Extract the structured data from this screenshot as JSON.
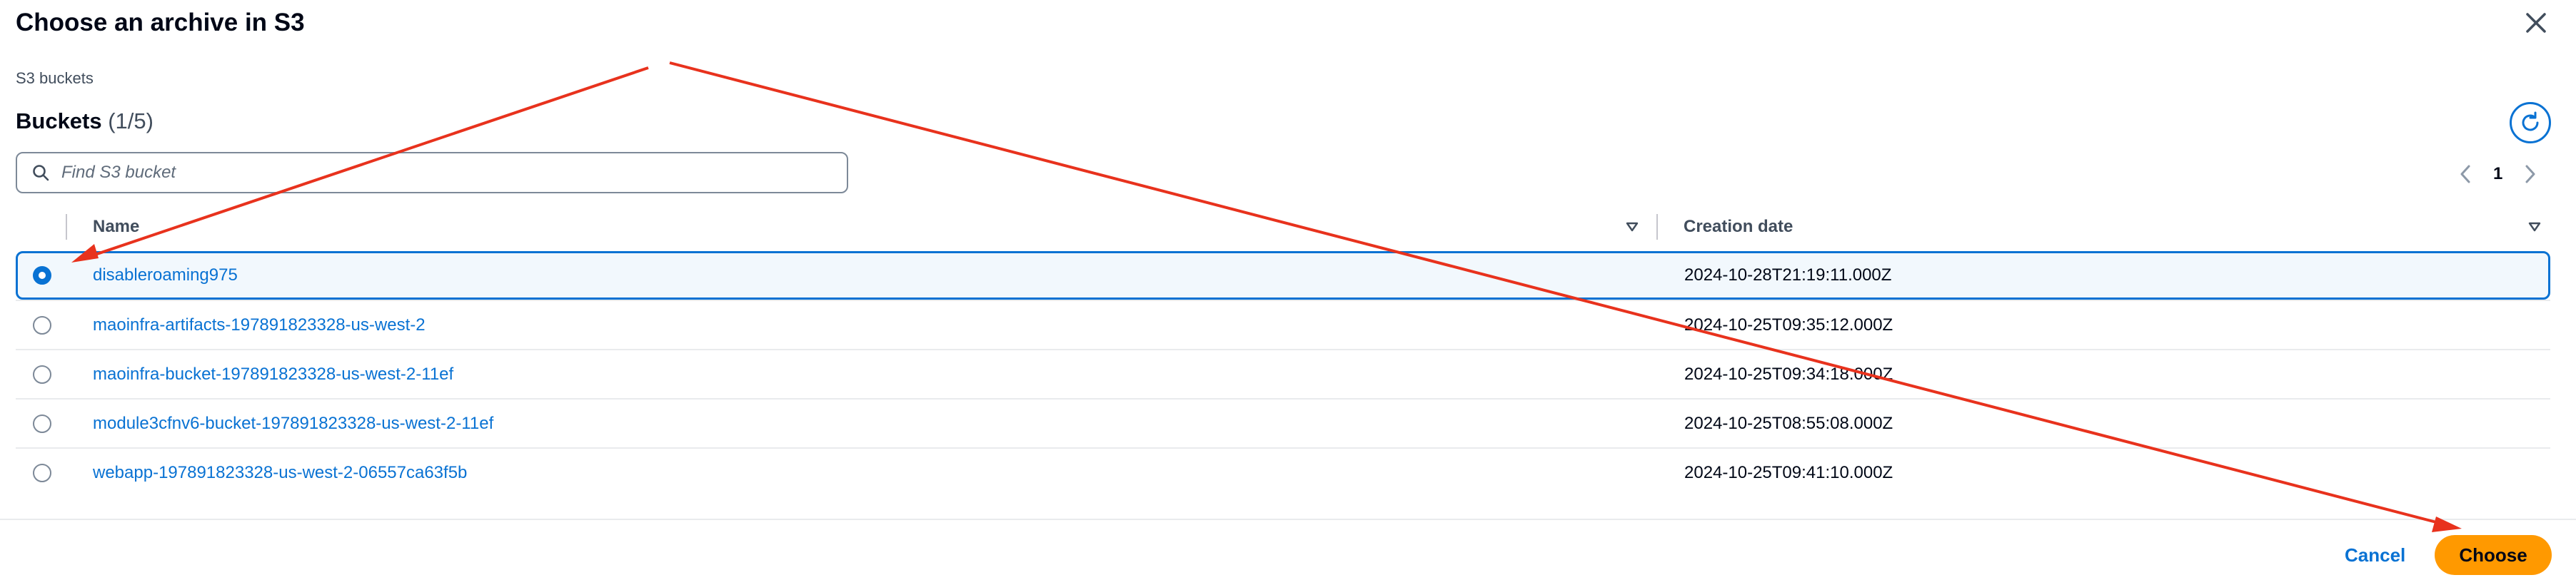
{
  "modal": {
    "title": "Choose an archive in S3",
    "section_label": "S3 buckets"
  },
  "buckets": {
    "heading": "Buckets",
    "count": "(1/5)"
  },
  "search": {
    "placeholder": "Find S3 bucket",
    "value": ""
  },
  "pagination": {
    "current_page": "1"
  },
  "table": {
    "columns": [
      "Name",
      "Creation date"
    ],
    "rows": [
      {
        "name": "disableroaming975",
        "date": "2024-10-28T21:19:11.000Z",
        "selected": true
      },
      {
        "name": "maoinfra-artifacts-197891823328-us-west-2",
        "date": "2024-10-25T09:35:12.000Z",
        "selected": false
      },
      {
        "name": "maoinfra-bucket-197891823328-us-west-2-11ef",
        "date": "2024-10-25T09:34:18.000Z",
        "selected": false
      },
      {
        "name": "module3cfnv6-bucket-197891823328-us-west-2-11ef",
        "date": "2024-10-25T08:55:08.000Z",
        "selected": false
      },
      {
        "name": "webapp-197891823328-us-west-2-06557ca63f5b",
        "date": "2024-10-25T09:41:10.000Z",
        "selected": false
      }
    ]
  },
  "footer": {
    "cancel_label": "Cancel",
    "choose_label": "Choose"
  },
  "colors": {
    "accent": "#0972d3",
    "primary_button": "#ff9900",
    "annotation_arrow": "#e8321d"
  },
  "icons": [
    "close-icon",
    "refresh-icon",
    "search-icon",
    "chevron-left-icon",
    "chevron-right-icon",
    "sort-down-icon"
  ]
}
